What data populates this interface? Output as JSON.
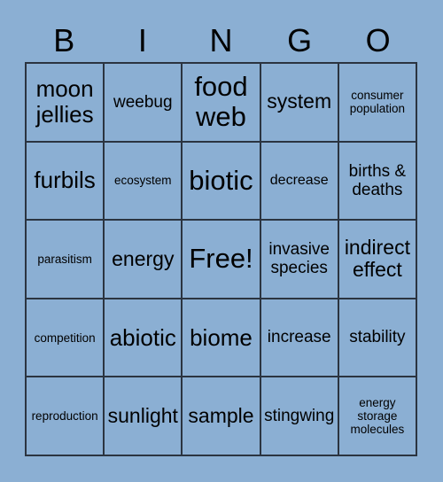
{
  "card": {
    "title_letters": [
      "B",
      "I",
      "N",
      "G",
      "O"
    ],
    "background_color": "#8bafd3",
    "border_color": "#2b3440",
    "text_color": "#000000",
    "columns": 5,
    "rows": 5,
    "free_space": "Free!",
    "cells": [
      [
        {
          "text": "moon jellies",
          "size": "s-xl"
        },
        {
          "text": "weebug",
          "size": "s-md"
        },
        {
          "text": "food web",
          "size": "s-xxl"
        },
        {
          "text": "system",
          "size": "s-lg"
        },
        {
          "text": "consumer population",
          "size": "s-xs"
        }
      ],
      [
        {
          "text": "furbils",
          "size": "s-xl"
        },
        {
          "text": "ecosystem",
          "size": "s-xs"
        },
        {
          "text": "biotic",
          "size": "s-xxl"
        },
        {
          "text": "decrease",
          "size": "s-sm"
        },
        {
          "text": "births & deaths",
          "size": "s-md"
        }
      ],
      [
        {
          "text": "parasitism",
          "size": "s-xs"
        },
        {
          "text": "energy",
          "size": "s-lg"
        },
        {
          "text": "Free!",
          "size": "s-xxl"
        },
        {
          "text": "invasive species",
          "size": "s-md"
        },
        {
          "text": "indirect effect",
          "size": "s-lg"
        }
      ],
      [
        {
          "text": "competition",
          "size": "s-xs"
        },
        {
          "text": "abiotic",
          "size": "s-xl"
        },
        {
          "text": "biome",
          "size": "s-xl"
        },
        {
          "text": "increase",
          "size": "s-md"
        },
        {
          "text": "stability",
          "size": "s-md"
        }
      ],
      [
        {
          "text": "reproduction",
          "size": "s-xs"
        },
        {
          "text": "sunlight",
          "size": "s-lg"
        },
        {
          "text": "sample",
          "size": "s-lg"
        },
        {
          "text": "stingwing",
          "size": "s-md"
        },
        {
          "text": "energy storage molecules",
          "size": "s-xs"
        }
      ]
    ]
  }
}
